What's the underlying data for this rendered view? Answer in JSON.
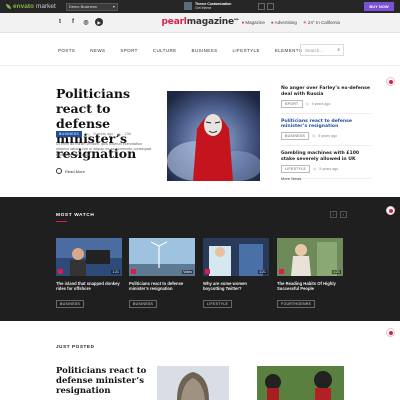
{
  "envato": {
    "brand": "envato",
    "brand_suffix": "market",
    "theme_select": "Demo Business",
    "info_title": "Theme Customization",
    "info_text": "Get theme",
    "buy_label": "BUY NOW"
  },
  "header": {
    "logo_part1": "pearl",
    "logo_part2": "magazine",
    "logo_tm": "wp",
    "right_links": [
      "Magazine",
      "Advertising",
      "24° In California"
    ]
  },
  "nav": {
    "items": [
      "POSTS",
      "NEWS",
      "SPORT",
      "CULTURE",
      "BUSINESS",
      "LIFESTYLE",
      "ELEMENTS"
    ],
    "search_placeholder": "Search..."
  },
  "hero": {
    "title": "Politicians react to defense minister’s resignation",
    "category": "BUSINESS",
    "time": "5 years ago",
    "views": "236",
    "excerpt": "Ut enim ad minim veniam, quis nostrud exercitation ullamco laboris nisi ut aliquip ex ea commodo consequat. Duis aute irure dolor.",
    "read_more": "Read More"
  },
  "side_news": [
    {
      "title": "No anger over Farley’s ex-defense deal with Russia",
      "category": "SPORT",
      "time": "5 years ago"
    },
    {
      "title": "Politicians react to defense minister’s resignation",
      "category": "BUSINESS",
      "time": "5 years ago"
    },
    {
      "title": "Gambling machines with £100 stake severely allowed in UK",
      "category": "LIFESTYLE",
      "time": "5 years ago"
    }
  ],
  "more_news": "More News",
  "most_watch": {
    "title": "MOST WATCH",
    "cards": [
      {
        "title": "The island that snapped donkey rides for offshore",
        "category": "BUSINESS",
        "duration": "1:21"
      },
      {
        "title": "Politicians react to defense minister’s resignation",
        "category": "BUSINESS",
        "duration": "Video"
      },
      {
        "title": "Why are some women boycotting Twitter?",
        "category": "LIFESTYLE",
        "duration": "1:21"
      },
      {
        "title": "The Reading Habits Of Highly Successful People",
        "category": "FOURTHGENRE",
        "duration": "1:21"
      }
    ]
  },
  "just_posted": {
    "title": "JUST POSTED",
    "lead_title": "Politicians react to defense minister’s resignation"
  },
  "colors": {
    "accent": "#d81f4b",
    "blue": "#1f4e9c",
    "dark": "#1f1f1f",
    "envato_green": "#82b440",
    "buy_purple": "#7b52d6"
  }
}
